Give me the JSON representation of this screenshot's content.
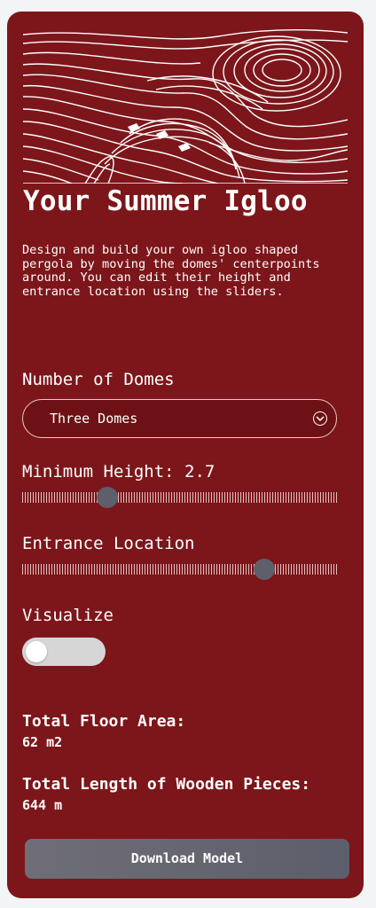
{
  "title": "Your Summer Igloo",
  "description": "Design and build your own igloo shaped pergola by moving the domes' centerpoints around. You can edit their height and entrance location using the sliders.",
  "domes": {
    "label": "Number of Domes",
    "selected": "Three Domes"
  },
  "min_height": {
    "label": "Minimum Height: 2.7",
    "fraction": 0.27
  },
  "entrance": {
    "label": "Entrance Location",
    "fraction": 0.77
  },
  "visualize": {
    "label": "Visualize",
    "on": false
  },
  "stats": {
    "floor_area_label": "Total Floor Area:",
    "floor_area_value": "62 m2",
    "wood_label": "Total Length of Wooden Pieces:",
    "wood_value": "644 m"
  },
  "download_label": "Download Model",
  "colors": {
    "panel": "#7c161a",
    "page_bg": "#f3f4f5",
    "thumb": "#5e5f6a",
    "toggle_track": "#d6d6d6"
  },
  "icons": {
    "select_arrow": "chevron-down-icon",
    "hero": "contour-lines-illustration"
  }
}
